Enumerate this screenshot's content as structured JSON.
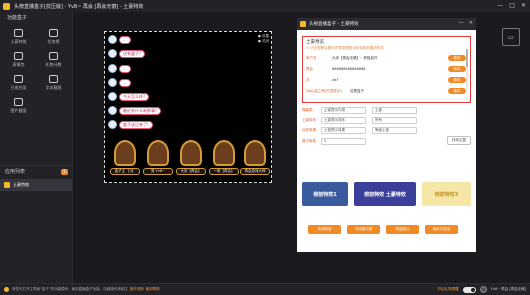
{
  "window": {
    "title": "头榜直播盒子[抗压版] - Yv8~ 再会 [再会无憾] - 土豪特效"
  },
  "sidebar": {
    "header": "功能盒子",
    "items": [
      {
        "label": "土豪特效"
      },
      {
        "label": "任务榜"
      },
      {
        "label": "表情包"
      },
      {
        "label": "礼物计数"
      },
      {
        "label": "已成任务"
      },
      {
        "label": "文本截图"
      },
      {
        "label": "图片截图"
      }
    ],
    "app_list_header": "应用列表",
    "app_list_count": "1",
    "app_item": "土豪特效"
  },
  "stage": {
    "controls": [
      "● 设置",
      "● 关闭"
    ],
    "messages": [
      {
        "text": "..."
      },
      {
        "text": "还有盒子?"
      },
      {
        "text": "..."
      },
      {
        "text": "..."
      },
      {
        "text": "今天怎么样?"
      },
      {
        "text": "最近有什么新鲜事?"
      },
      {
        "text": "盒子送过来了!"
      }
    ],
    "gifts": [
      {
        "label": "盒子主 【3】"
      },
      {
        "label": "秀 Yv8~"
      },
      {
        "label": "大宋【再会】"
      },
      {
        "label": "一帆【再会】"
      },
      {
        "label": "再会游戏大神"
      }
    ]
  },
  "dialog": {
    "title": "头榜直播盒子 - 土豪特效",
    "section_title": "土豪预览",
    "hint": "① 已为您默认提示可预览按钮对应特效的展示样式",
    "rows": [
      {
        "name": "用户名",
        "value": "大宋【再会无憾】：积极如许",
        "action": "修改"
      },
      {
        "name": "再会",
        "value": "666666666666666",
        "action": "修改"
      },
      {
        "name": "花",
        "value": "zb7",
        "action": "修改"
      },
      {
        "name": "Dg公益之声[打赏提示]",
        "value": "这是盒子",
        "action": "修改"
      }
    ],
    "filters": [
      {
        "label": "弹幕类：",
        "value": "土豪提示礼物"
      },
      {
        "label": "土豪特效：",
        "value": "土豪提示排序"
      },
      {
        "label": "动态效果：",
        "value": "土豪提示效果"
      },
      {
        "label": "展示条数：",
        "value": "5"
      }
    ],
    "filter_options": [
      "土豪",
      "所有",
      "等级土豪"
    ],
    "position_button": "特效位置",
    "styles": [
      {
        "label": "榜前特效1"
      },
      {
        "label": "榜前特效 土豪特效"
      },
      {
        "label": "榜前特效3"
      }
    ],
    "actions": [
      "关闭特效",
      "关闭提示框",
      "恢复默认",
      "保存并退出"
    ]
  },
  "statusbar": {
    "text": "请您先打开主界面“盒子”的功能模块，使用直播盒子功能，详细操作请前往",
    "link1": "操作说明",
    "link2": "使用帮助",
    "right_label": "开启礼物提醒",
    "user": "Yv8~ 再会 [再会无憾]"
  }
}
